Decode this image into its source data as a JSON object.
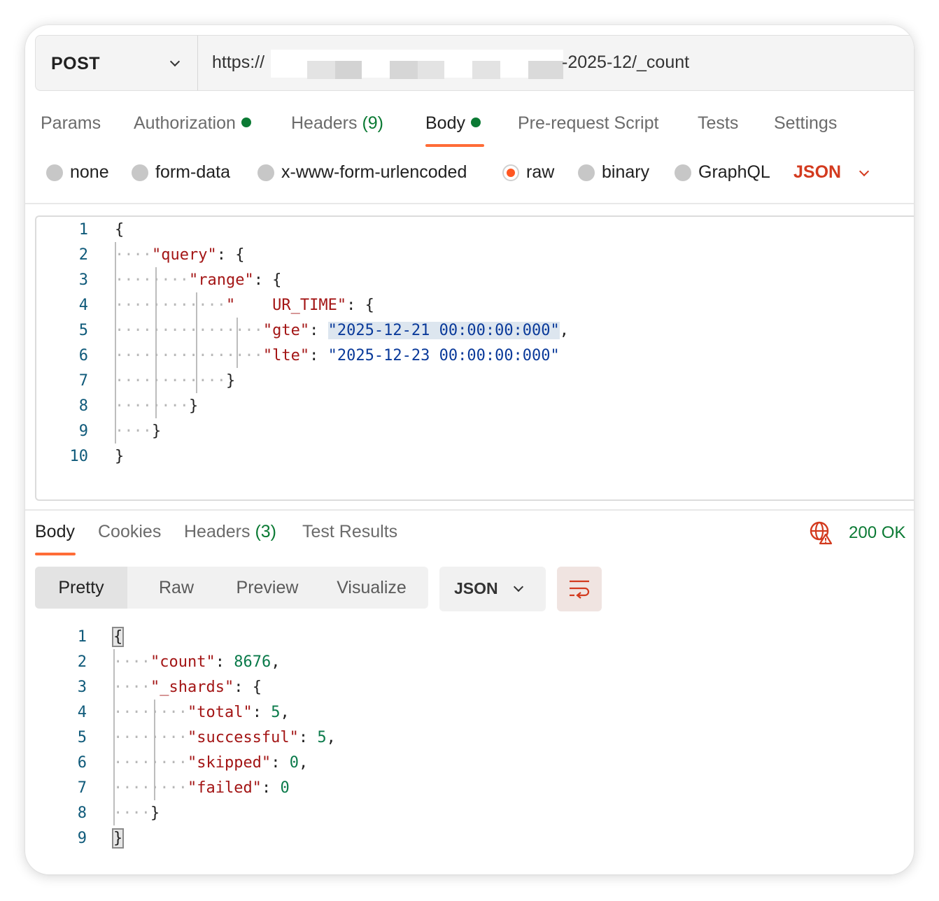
{
  "request": {
    "method": "POST",
    "url_prefix": "https://",
    "url_suffix": "-2025-12/_count"
  },
  "tabs": [
    {
      "label": "Params"
    },
    {
      "label": "Authorization"
    },
    {
      "label": "Headers",
      "count": "(9)"
    },
    {
      "label": "Body"
    },
    {
      "label": "Pre-request Script"
    },
    {
      "label": "Tests"
    },
    {
      "label": "Settings"
    }
  ],
  "body_types": [
    {
      "label": "none"
    },
    {
      "label": "form-data"
    },
    {
      "label": "x-www-form-urlencoded"
    },
    {
      "label": "raw",
      "selected": true
    },
    {
      "label": "binary"
    },
    {
      "label": "GraphQL"
    }
  ],
  "body_format": "JSON",
  "request_body_lines": [
    "{",
    "    \"query\": {",
    "        \"range\": {",
    "            \"    UR_TIME\": {",
    "                \"gte\": \"2025-12-21 00:00:00:000\",",
    "                \"lte\": \"2025-12-23 00:00:00:000\"",
    "            }",
    "        }",
    "    }",
    "}"
  ],
  "response": {
    "tabs": [
      {
        "label": "Body"
      },
      {
        "label": "Cookies"
      },
      {
        "label": "Headers",
        "count": "(3)"
      },
      {
        "label": "Test Results"
      }
    ],
    "status": "200 OK",
    "view_modes": [
      "Pretty",
      "Raw",
      "Preview",
      "Visualize"
    ],
    "format": "JSON",
    "body_lines": [
      "{",
      "    \"count\": 8676,",
      "    \"_shards\": {",
      "        \"total\": 5,",
      "        \"successful\": 5,",
      "        \"skipped\": 0,",
      "        \"failed\": 0",
      "    }",
      "}"
    ],
    "json": {
      "count": "8676",
      "total": "5",
      "successful": "5",
      "skipped": "0",
      "failed": "0"
    }
  },
  "colors": {
    "accent": "#ff6c37",
    "status_green": "#0b7a34",
    "key_red": "#a31515",
    "string_blue": "#0a3a9a"
  }
}
